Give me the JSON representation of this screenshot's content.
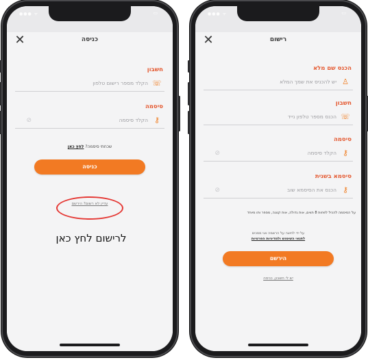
{
  "colors": {
    "accent": "#f27a23",
    "label": "#e4572e",
    "annotation": "#e53935"
  },
  "login": {
    "title": "כניסה",
    "close_icon": "close-icon",
    "account_label": "חשבון",
    "phone_placeholder": "הקלד מספר רישום טלפון",
    "password_label": "סיסמה",
    "password_placeholder": "הקלד סיסמה",
    "forgot_text": "שכחתי סיסמה?",
    "forgot_link": "לחץ כאן",
    "submit_label": "כניסה",
    "register_link": "עדיין לא רשום? הירשם",
    "annotation_text": "לרישום לחץ כאן"
  },
  "register": {
    "title": "רישום",
    "close_icon": "close-icon",
    "fullname_label": "הכנס שם מלא",
    "fullname_placeholder": "יש להכניס את שמך המלא",
    "account_label": "חשבון",
    "phone_placeholder": "הכנס מספר טלפון נייד",
    "password_label": "סיסמה",
    "password_placeholder": "הקלד סיסמה",
    "confirm_label": "סיסמא בשנית",
    "confirm_placeholder": "הכנס את הסיסמא שוב",
    "password_rules": "על הסיסמה להכיל לפחות 8 תווים, אות גדולה, אות קטנה, מספר ותו מיוחד",
    "terms_prefix": "על ידי לחיצה על הרשמה אני מסכים",
    "terms_link": "לתנאי השימוש ולמדיניות הפרטיות",
    "submit_label": "הירשם",
    "login_link": "יש לי חשבון, כניסה"
  }
}
